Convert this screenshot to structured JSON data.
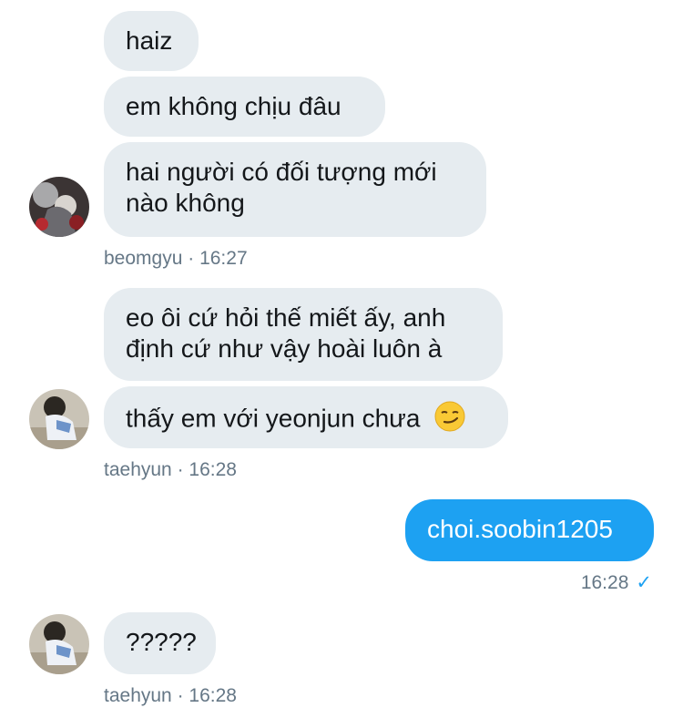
{
  "messages": [
    {
      "text": "haiz"
    },
    {
      "text": "em không chịu đâu"
    },
    {
      "line1": "hai người có đối tượng mới",
      "line2": "nào không"
    },
    {
      "line1": "eo ôi cứ hỏi thế miết ấy, anh",
      "line2": "định cứ như vậy hoài luôn à"
    },
    {
      "text": "thấy em với yeonjun chưa",
      "emoji": "smirking-face-emoji"
    },
    {
      "text": "choi.soobin1205"
    },
    {
      "text": "?????"
    }
  ],
  "groups": [
    {
      "sender": "beomgyu",
      "separator": "·",
      "time": "16:27"
    },
    {
      "sender": "taehyun",
      "separator": "·",
      "time": "16:28"
    },
    {
      "time": "16:28",
      "check": "✓"
    },
    {
      "sender": "taehyun",
      "separator": "·",
      "time": "16:28"
    }
  ],
  "colors": {
    "incoming_bubble": "#e6ecf0",
    "outgoing_bubble": "#1da1f2",
    "meta_text": "#657786"
  }
}
